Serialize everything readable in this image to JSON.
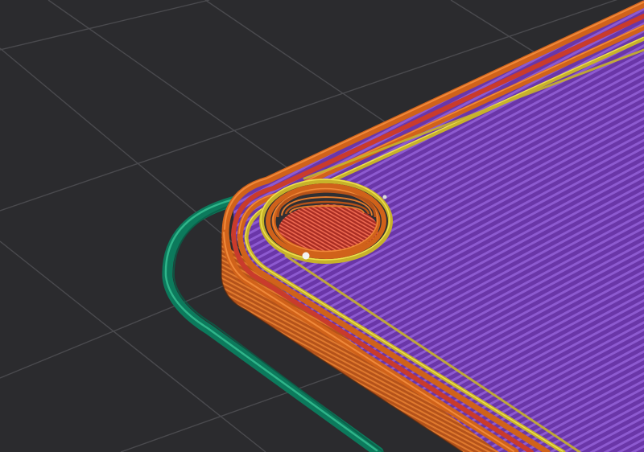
{
  "viewer": {
    "background_color": "#2b2b2e",
    "grid_color": "#4a4a4e"
  },
  "feature_colors": {
    "skirt": "#0c7a5c",
    "skirt_highlight": "#2fb58a",
    "outer_wall": "#d0621a",
    "outer_wall_highlight": "#f0893a",
    "inner_wall": "#c7b22a",
    "inner_wall_highlight": "#eee04e",
    "wall_red": "#c93b2c",
    "wall_red_highlight": "#ef6a52",
    "top_infill": "#6a36a8",
    "top_infill_highlight": "#8d5ad0",
    "seam_marker": "#f2f2f2"
  },
  "icons": {
    "seam": "seam-marker-icon"
  }
}
